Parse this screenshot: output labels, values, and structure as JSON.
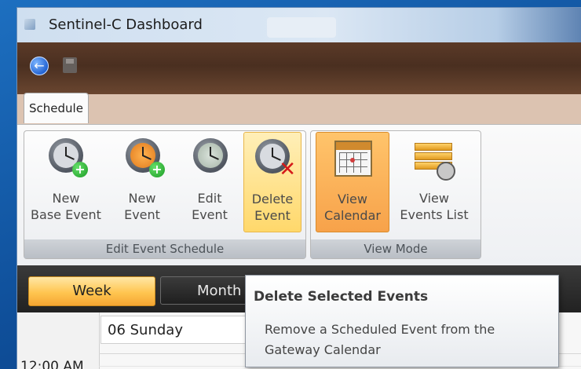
{
  "window": {
    "title": "Sentinel-C Dashboard"
  },
  "quick_access": {
    "back_icon": "back-arrow-icon",
    "save_icon": "save-icon"
  },
  "ribbon": {
    "tab": "Schedule",
    "groups": [
      {
        "label": "Edit Event Schedule",
        "buttons": [
          {
            "line1": "New",
            "line2": "Base Event",
            "icon": "clock-add-icon"
          },
          {
            "line1": "New",
            "line2": "Event",
            "icon": "clock-add-orange-icon"
          },
          {
            "line1": "Edit",
            "line2": "Event",
            "icon": "clock-edit-icon"
          },
          {
            "line1": "Delete",
            "line2": "Event",
            "icon": "clock-delete-icon",
            "state": "hover"
          }
        ]
      },
      {
        "label": "View Mode",
        "buttons": [
          {
            "line1": "View",
            "line2": "Calendar",
            "icon": "calendar-icon",
            "state": "active"
          },
          {
            "line1": "View",
            "line2": "Events List",
            "icon": "events-list-icon"
          }
        ]
      }
    ]
  },
  "view_tabs": {
    "week": "Week",
    "month": "Month",
    "selected": "Week"
  },
  "calendar": {
    "day_header": "06 Sunday",
    "time_label": "12:00 AM"
  },
  "tooltip": {
    "title": "Delete Selected Events",
    "body": "Remove a Scheduled Event from the Gateway Calendar"
  }
}
